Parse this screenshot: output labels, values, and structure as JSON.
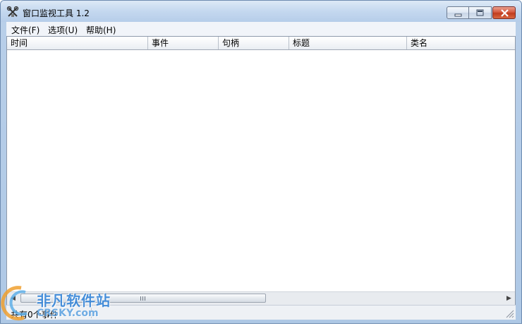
{
  "window": {
    "title": "窗口监视工具 1.2",
    "icon": "app-tool-icon"
  },
  "caption_buttons": {
    "minimize": "minimize-icon",
    "maximize": "restore-icon",
    "close": "close-icon"
  },
  "menu": {
    "items": [
      {
        "label": "文件(F)"
      },
      {
        "label": "选项(U)"
      },
      {
        "label": "帮助(H)"
      }
    ]
  },
  "table": {
    "columns": [
      "时间",
      "事件",
      "句柄",
      "标题",
      "类名"
    ],
    "rows": []
  },
  "scrollbar": {
    "left_arrow": "◀",
    "right_arrow": "▶"
  },
  "status": {
    "text": "共有0个事件"
  },
  "watermark": {
    "cn": "非凡软件站",
    "en": "CRSKY.com"
  },
  "colors": {
    "accent": "#2b7fd6",
    "close_button": "#c03c1f",
    "frame": "#b8cfe9"
  }
}
